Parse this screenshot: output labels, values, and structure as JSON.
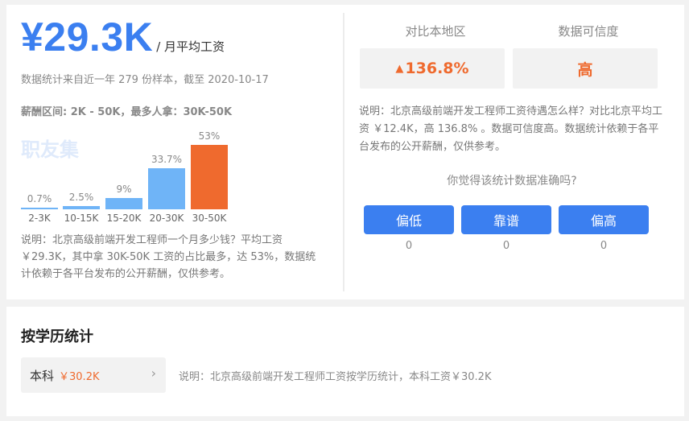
{
  "summary": {
    "salary": "¥29.3K",
    "unit": "/ 月平均工资",
    "sample": "数据统计来自近一年 279 份样本，截至 2020-10-17",
    "range": "薪酬区间: 2K - 50K，最多人拿：30K-50K",
    "watermark": "职友集",
    "description": "说明：北京高级前端开发工程师一个月多少钱？平均工资￥29.3K，其中拿 30K-50K 工资的占比最多，达 53%，数据统计依赖于各平台发布的公开薪酬，仅供参考。"
  },
  "chart_data": {
    "type": "bar",
    "categories": [
      "2-3K",
      "10-15K",
      "15-20K",
      "20-30K",
      "30-50K"
    ],
    "values": [
      0.7,
      2.5,
      9,
      33.7,
      53
    ],
    "labels": [
      "0.7%",
      "2.5%",
      "9%",
      "33.7%",
      "53%"
    ],
    "ylim": [
      0,
      53
    ],
    "colors": {
      "normal": "#6fb4f7",
      "highlight": "#ef6a2e"
    }
  },
  "compare": {
    "region_head": "对比本地区",
    "credibility_head": "数据可信度",
    "region_value": "136.8%",
    "credibility_value": "高",
    "description": "说明：北京高级前端开发工程师工资待遇怎么样？对比北京平均工资 ￥12.4K，高 136.8% 。数据可信度高。数据统计依赖于各平台发布的公开薪酬，仅供参考。",
    "question": "你觉得该统计数据准确吗?",
    "votes": [
      {
        "label": "偏低",
        "count": "0"
      },
      {
        "label": "靠谱",
        "count": "0"
      },
      {
        "label": "偏高",
        "count": "0"
      }
    ]
  },
  "education": {
    "title": "按学历统计",
    "item_name": "本科",
    "item_salary": "￥30.2K",
    "description": "说明：北京高级前端开发工程师工资按学历统计，本科工资￥30.2K"
  },
  "colors": {
    "accent": "#3b7ff0",
    "hot": "#ef6a2e"
  },
  "icons": {
    "trend": "arrow-up-icon",
    "chevron": "chevron-right-icon"
  }
}
